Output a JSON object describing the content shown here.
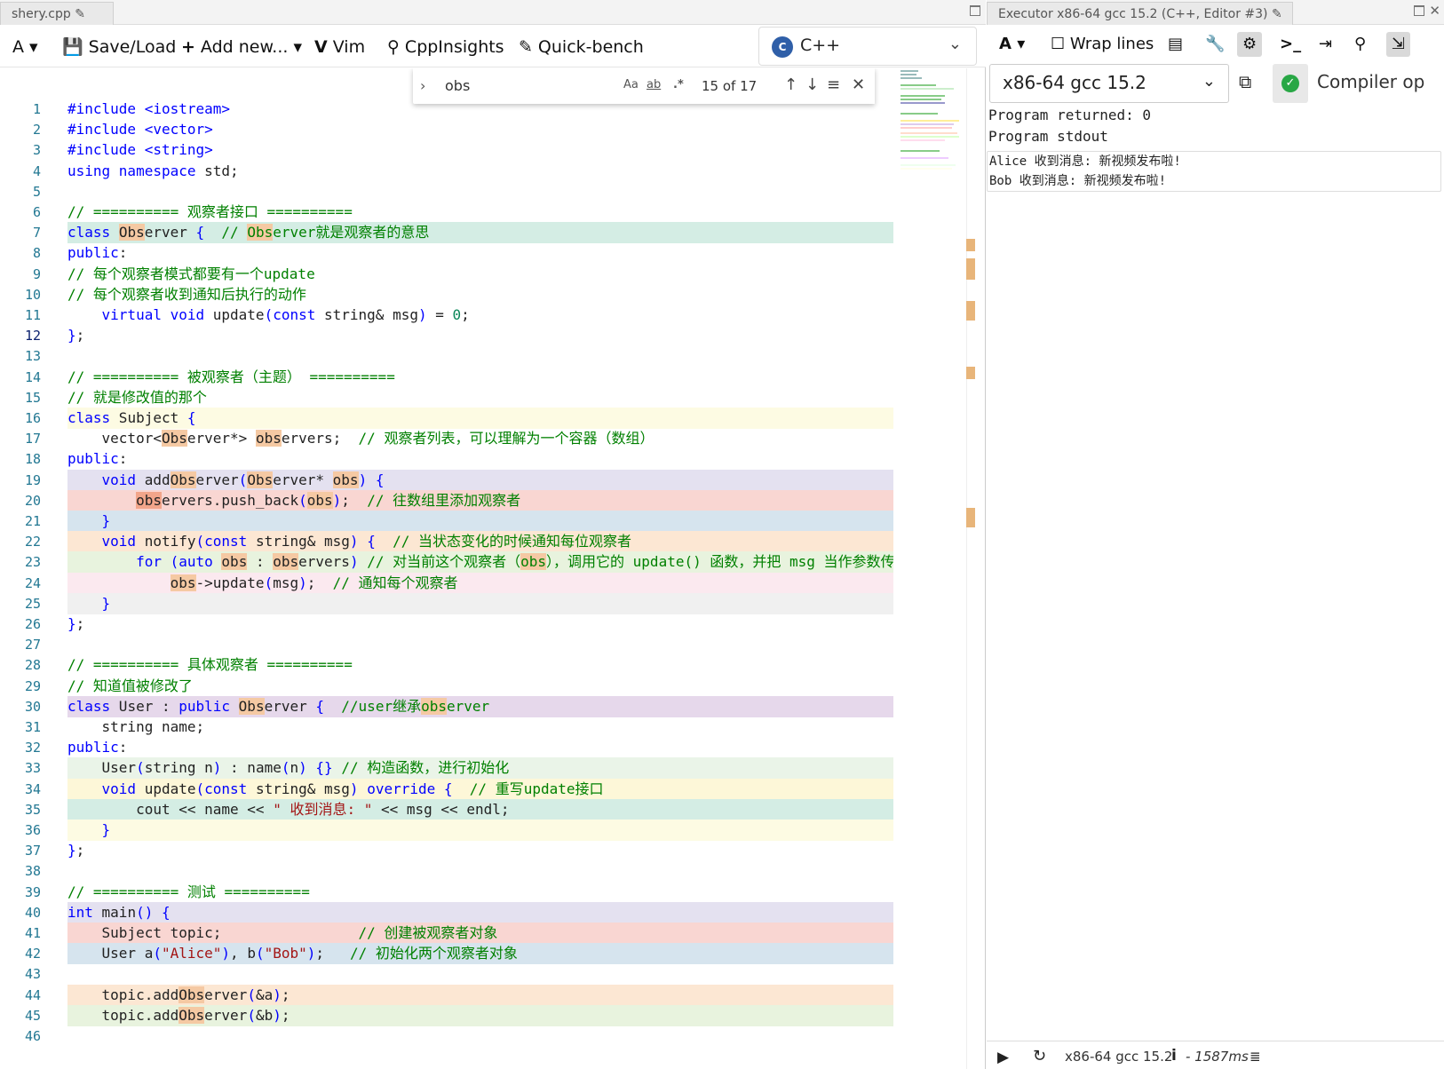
{
  "left": {
    "tab_label": "shery.cpp ✎",
    "toolbar": {
      "font_label": "A ▾",
      "saveload": "Save/Load",
      "addnew": "Add new...",
      "vim": "Vim",
      "cppinsights": "CppInsights",
      "quickbench": "Quick-bench",
      "language": "C++"
    },
    "find": {
      "query": "obs",
      "case_opt": "Aa",
      "word_opt": "ab",
      "regex_opt": ".*",
      "count": "15 of 17"
    },
    "lines": [
      {
        "n": "1",
        "html": "<span class=\"pp\">#include</span> <span class=\"kw\">&lt;iostream&gt;</span>",
        "bg": ""
      },
      {
        "n": "2",
        "html": "<span class=\"pp\">#include</span> <span class=\"kw\">&lt;vector&gt;</span>",
        "bg": ""
      },
      {
        "n": "3",
        "html": "<span class=\"pp\">#include</span> <span class=\"kw\">&lt;string&gt;</span>",
        "bg": ""
      },
      {
        "n": "4",
        "html": "<span class=\"kw\">using namespace</span> std;",
        "bg": ""
      },
      {
        "n": "5",
        "html": "",
        "bg": ""
      },
      {
        "n": "6",
        "html": "<span class=\"cm\">// ========== 观察者接口 ==========</span>",
        "bg": ""
      },
      {
        "n": "7",
        "html": "<span class=\"kw\">class</span> <span class=\"m\">Obs</span>erver <span class=\"kw\">{</span>  <span class=\"cm\">// <span class=\"m\">Obs</span>erver就是观察者的意思</span>",
        "bg": "#d4ede4"
      },
      {
        "n": "8",
        "html": "<span class=\"kw\">public</span>:",
        "bg": ""
      },
      {
        "n": "9",
        "html": "<span class=\"cm\">// 每个观察者模式都要有一个update</span>",
        "bg": ""
      },
      {
        "n": "10",
        "html": "<span class=\"cm\">// 每个观察者收到通知后执行的动作</span>",
        "bg": ""
      },
      {
        "n": "11",
        "html": "    <span class=\"kw\">virtual void</span> update<span class=\"kw\">(</span><span class=\"kw\">const</span> string&amp; msg<span class=\"kw\">)</span> = <span class=\"num\">0</span>;",
        "bg": ""
      },
      {
        "n": "12",
        "html": "<span class=\"kw\">}</span>;",
        "bg": ""
      },
      {
        "n": "13",
        "html": "",
        "bg": ""
      },
      {
        "n": "14",
        "html": "<span class=\"cm\">// ========== 被观察者（主题） ==========</span>",
        "bg": ""
      },
      {
        "n": "15",
        "html": "<span class=\"cm\">// 就是修改值的那个</span>",
        "bg": ""
      },
      {
        "n": "16",
        "html": "<span class=\"kw\">class</span> Subject <span class=\"kw\">{</span>",
        "bg": "#fdfbe3"
      },
      {
        "n": "17",
        "html": "    vector&lt;<span class=\"m\">Obs</span>erver*&gt; <span class=\"m\">obs</span>ervers;  <span class=\"cm\">// 观察者列表，可以理解为一个容器（数组）</span>",
        "bg": ""
      },
      {
        "n": "18",
        "html": "<span class=\"kw\">public</span>:",
        "bg": ""
      },
      {
        "n": "19",
        "html": "    <span class=\"kw\">void</span> add<span class=\"m\">Obs</span>erver<span class=\"kw\">(</span><span class=\"m\">Obs</span>erver* <span class=\"m\">obs</span><span class=\"kw\">)</span> <span class=\"kw\">{</span>",
        "bg": "#e4e1f0"
      },
      {
        "n": "20",
        "html": "        <span class=\"m2\">obs</span>ervers.push_back<span class=\"kw\">(</span><span class=\"m\">obs</span><span class=\"kw\">)</span>;  <span class=\"cm\">// 往数组里添加观察者</span>",
        "bg": "#f9d6d2"
      },
      {
        "n": "21",
        "html": "    <span class=\"kw\">}</span>",
        "bg": "#d6e4ee"
      },
      {
        "n": "22",
        "html": "    <span class=\"kw\">void</span> notify<span class=\"kw\">(</span><span class=\"kw\">const</span> string&amp; msg<span class=\"kw\">)</span> <span class=\"kw\">{</span>  <span class=\"cm\">// 当状态变化的时候通知每位观察者</span>",
        "bg": "#fce7d3"
      },
      {
        "n": "23",
        "html": "        <span class=\"kw\">for</span> <span class=\"kw\">(</span><span class=\"kw\">auto</span> <span class=\"m\">obs</span> : <span class=\"m\">obs</span>ervers<span class=\"kw\">)</span> <span class=\"cm\">// 对当前这个观察者（<span class=\"m\">obs</span>），调用它的 update() 函数，并把 msg 当作参数传给它</span>",
        "bg": "#e8f3de"
      },
      {
        "n": "24",
        "html": "            <span class=\"m\">obs</span>-&gt;update<span class=\"kw\">(</span>msg<span class=\"kw\">)</span>;  <span class=\"cm\">// 通知每个观察者</span>",
        "bg": "#fbe9ef"
      },
      {
        "n": "25",
        "html": "    <span class=\"kw\">}</span>",
        "bg": "#f0f0f0"
      },
      {
        "n": "26",
        "html": "<span class=\"kw\">}</span>;",
        "bg": ""
      },
      {
        "n": "27",
        "html": "",
        "bg": ""
      },
      {
        "n": "28",
        "html": "<span class=\"cm\">// ========== 具体观察者 ==========</span>",
        "bg": ""
      },
      {
        "n": "29",
        "html": "<span class=\"cm\">// 知道值被修改了</span>",
        "bg": ""
      },
      {
        "n": "30",
        "html": "<span class=\"kw\">class</span> User : <span class=\"kw\">public</span> <span class=\"m\">Obs</span>erver <span class=\"kw\">{</span>  <span class=\"cm\">//user继承<span class=\"m\">obs</span>erver</span>",
        "bg": "#e6d8eb"
      },
      {
        "n": "31",
        "html": "    string name;",
        "bg": ""
      },
      {
        "n": "32",
        "html": "<span class=\"kw\">public</span>:",
        "bg": ""
      },
      {
        "n": "33",
        "html": "    User<span class=\"kw\">(</span>string n<span class=\"kw\">)</span> : name<span class=\"kw\">(</span>n<span class=\"kw\">)</span> <span class=\"kw\">{}</span> <span class=\"cm\">// 构造函数，进行初始化</span>",
        "bg": "#eaf4e8"
      },
      {
        "n": "34",
        "html": "    <span class=\"kw\">void</span> update<span class=\"kw\">(</span><span class=\"kw\">const</span> string&amp; msg<span class=\"kw\">)</span> <span class=\"kw\">override</span> <span class=\"kw\">{</span>  <span class=\"cm\">// 重写update接口</span>",
        "bg": "#fdf7d8"
      },
      {
        "n": "35",
        "html": "        cout &lt;&lt; name &lt;&lt; <span class=\"str\">\" 收到消息: \"</span> &lt;&lt; msg &lt;&lt; endl;",
        "bg": "#d4ede4"
      },
      {
        "n": "36",
        "html": "    <span class=\"kw\">}</span>",
        "bg": "#fdfbe3"
      },
      {
        "n": "37",
        "html": "<span class=\"kw\">}</span>;",
        "bg": ""
      },
      {
        "n": "38",
        "html": "",
        "bg": ""
      },
      {
        "n": "39",
        "html": "<span class=\"cm\">// ========== 测试 ==========</span>",
        "bg": ""
      },
      {
        "n": "40",
        "html": "<span class=\"kw\">int</span> main<span class=\"kw\">()</span> <span class=\"kw\">{</span>",
        "bg": "#e4e1f0"
      },
      {
        "n": "41",
        "html": "    Subject topic;                <span class=\"cm\">// 创建被观察者对象</span>",
        "bg": "#f9d6d2"
      },
      {
        "n": "42",
        "html": "    User a<span class=\"kw\">(</span><span class=\"str\">\"Alice\"</span><span class=\"kw\">)</span>, b<span class=\"kw\">(</span><span class=\"str\">\"Bob\"</span><span class=\"kw\">)</span>;   <span class=\"cm\">// 初始化两个观察者对象</span>",
        "bg": "#d6e4ee"
      },
      {
        "n": "43",
        "html": "",
        "bg": ""
      },
      {
        "n": "44",
        "html": "    topic.add<span class=\"m\">Obs</span>erver<span class=\"kw\">(</span>&amp;a<span class=\"kw\">)</span>;",
        "bg": "#fce7d3"
      },
      {
        "n": "45",
        "html": "    topic.add<span class=\"m\">Obs</span>erver<span class=\"kw\">(</span>&amp;b<span class=\"kw\">)</span>;",
        "bg": "#e8f3de"
      },
      {
        "n": "46",
        "html": "",
        "bg": ""
      }
    ]
  },
  "right": {
    "tab_label": "Executor x86-64 gcc 15.2 (C++, Editor #3) ✎",
    "toolbar": {
      "font_label": "A ▾",
      "wrap": "Wrap lines"
    },
    "compiler": "x86-64 gcc 15.2",
    "compiler_options_placeholder": "Compiler op",
    "output": {
      "returned": "Program returned: 0",
      "stdout_label": "Program stdout",
      "stdout_lines": [
        "Alice 收到消息: 新视频发布啦!",
        "Bob 收到消息: 新视频发布啦!"
      ]
    },
    "status": {
      "compiler": "x86-64 gcc 15.2",
      "time": "- 1587ms"
    }
  }
}
